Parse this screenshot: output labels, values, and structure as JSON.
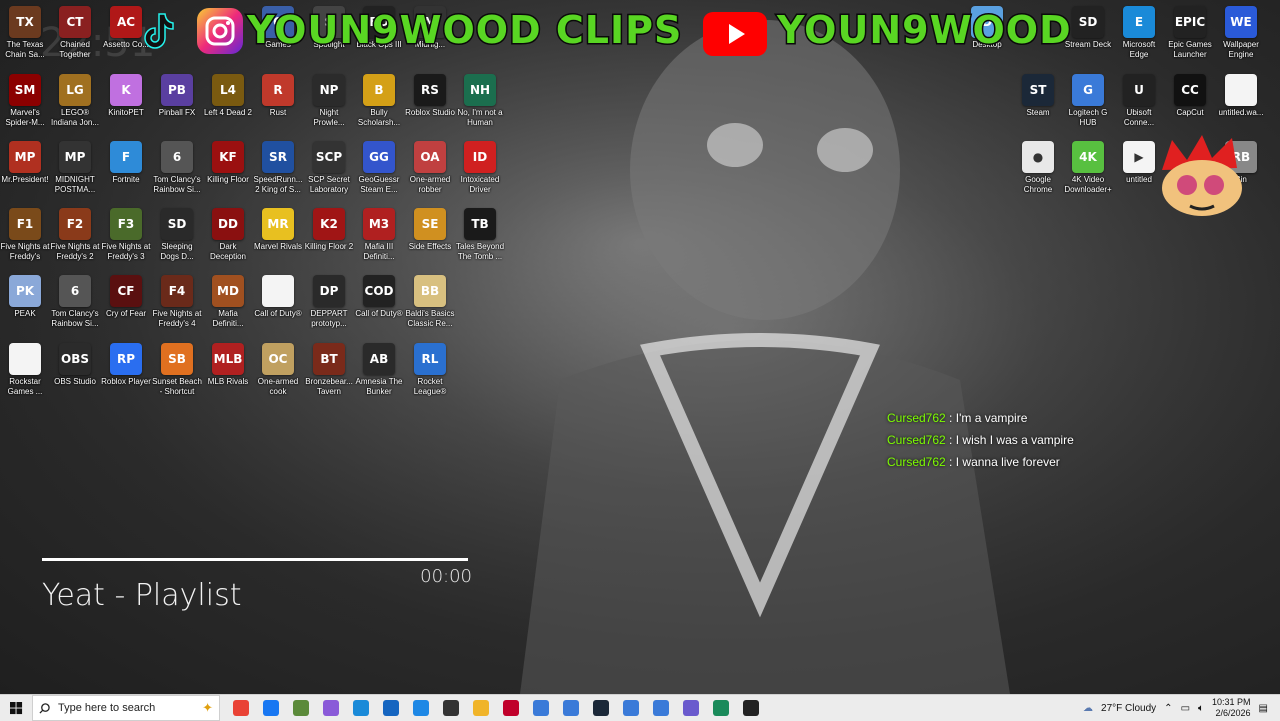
{
  "desktop": {
    "icons": [
      {
        "label": "The Texas Chain Sa...",
        "color": "#6b3a1f",
        "glyph": "TX"
      },
      {
        "label": "Chained Together",
        "color": "#8a2020",
        "glyph": "CT"
      },
      {
        "label": "Assetto Co...",
        "color": "#b01818",
        "glyph": "AC"
      },
      {
        "label": "Games",
        "color": "#3a5fa8",
        "glyph": "G"
      },
      {
        "label": "Spotlight",
        "color": "#444",
        "glyph": "S"
      },
      {
        "label": "Black Ops III",
        "color": "#222",
        "glyph": "BO"
      },
      {
        "label": "Midnig...",
        "color": "#333",
        "glyph": "M"
      },
      {
        "label": "Marvel's Spider-M...",
        "color": "#8b0000",
        "glyph": "SM"
      },
      {
        "label": "LEGO® Indiana Jon...",
        "color": "#a07020",
        "glyph": "LG"
      },
      {
        "label": "KinitoPET",
        "color": "#c070e0",
        "glyph": "K"
      },
      {
        "label": "Pinball FX",
        "color": "#5a3fa0",
        "glyph": "PB"
      },
      {
        "label": "Left 4 Dead 2",
        "color": "#7a5a10",
        "glyph": "L4"
      },
      {
        "label": "Rust",
        "color": "#c0392b",
        "glyph": "R"
      },
      {
        "label": "Night Prowle...",
        "color": "#2b2b2b",
        "glyph": "NP"
      },
      {
        "label": "Bully Scholarsh...",
        "color": "#d4a017",
        "glyph": "B"
      },
      {
        "label": "Roblox Studio",
        "color": "#1a1a1a",
        "glyph": "RS"
      },
      {
        "label": "No, I'm not a Human",
        "color": "#1b6e4e",
        "glyph": "NH"
      },
      {
        "label": "Mr.President!",
        "color": "#b03020",
        "glyph": "MP"
      },
      {
        "label": "MIDNIGHT POSTMA...",
        "color": "#333",
        "glyph": "MP"
      },
      {
        "label": "Fortnite",
        "color": "#2e8bd8",
        "glyph": "F"
      },
      {
        "label": "Tom Clancy's Rainbow Si...",
        "color": "#555",
        "glyph": "6"
      },
      {
        "label": "Killing Floor",
        "color": "#9b1010",
        "glyph": "KF"
      },
      {
        "label": "SpeedRunn... 2 King of S...",
        "color": "#2050a0",
        "glyph": "SR"
      },
      {
        "label": "SCP Secret Laboratory",
        "color": "#333",
        "glyph": "SCP"
      },
      {
        "label": "GeoGuessr Steam E...",
        "color": "#3355cc",
        "glyph": "GG"
      },
      {
        "label": "One-armed robber",
        "color": "#c04040",
        "glyph": "OA"
      },
      {
        "label": "Intoxicated Driver",
        "color": "#d02020",
        "glyph": "ID"
      },
      {
        "label": "Five Nights at Freddy's",
        "color": "#7a4a1a",
        "glyph": "F1"
      },
      {
        "label": "Five Nights at Freddy's 2",
        "color": "#8a3a1a",
        "glyph": "F2"
      },
      {
        "label": "Five Nights at Freddy's 3",
        "color": "#4a6a2a",
        "glyph": "F3"
      },
      {
        "label": "Sleeping Dogs D...",
        "color": "#2a2a2a",
        "glyph": "SD"
      },
      {
        "label": "Dark Deception",
        "color": "#8a1010",
        "glyph": "DD"
      },
      {
        "label": "Marvel Rivals",
        "color": "#e8c020",
        "glyph": "MR"
      },
      {
        "label": "Killing Floor 2",
        "color": "#a01515",
        "glyph": "K2"
      },
      {
        "label": "Mafia III Definiti...",
        "color": "#b02020",
        "glyph": "M3"
      },
      {
        "label": "Side Effects",
        "color": "#d09020",
        "glyph": "SE"
      },
      {
        "label": "Tales Beyond The Tomb ...",
        "color": "#1a1a1a",
        "glyph": "TB"
      },
      {
        "label": "PEAK",
        "color": "#8aa8d8",
        "glyph": "PK"
      },
      {
        "label": "Tom Clancy's Rainbow Si...",
        "color": "#555",
        "glyph": "6"
      },
      {
        "label": "Cry of Fear",
        "color": "#5a1010",
        "glyph": "CF"
      },
      {
        "label": "Five Nights at Freddy's 4",
        "color": "#6a2a1a",
        "glyph": "F4"
      },
      {
        "label": "Mafia Definiti...",
        "color": "#a05020",
        "glyph": "MD"
      },
      {
        "label": "Call of Duty®",
        "color": "#f4f4f4",
        "glyph": ""
      },
      {
        "label": "DEPPART prototyp...",
        "color": "#2a2a2a",
        "glyph": "DP"
      },
      {
        "label": "Call of Duty®",
        "color": "#222",
        "glyph": "COD"
      },
      {
        "label": "Baldi's Basics Classic Re...",
        "color": "#d8c080",
        "glyph": "BB"
      },
      {
        "label": "Rockstar Games ...",
        "color": "#f4f4f4",
        "glyph": ""
      },
      {
        "label": "OBS Studio",
        "color": "#2b2b2b",
        "glyph": "OBS"
      },
      {
        "label": "Roblox Player",
        "color": "#2a6ef0",
        "glyph": "RP"
      },
      {
        "label": "Sunset Beach - Shortcut",
        "color": "#e07020",
        "glyph": "SB"
      },
      {
        "label": "MLB Rivals",
        "color": "#b02020",
        "glyph": "MLB"
      },
      {
        "label": "One-armed cook",
        "color": "#c0a060",
        "glyph": "OC"
      },
      {
        "label": "Bronzebear... Tavern",
        "color": "#7a2a1a",
        "glyph": "BT"
      },
      {
        "label": "Amnesia The Bunker",
        "color": "#2a2a2a",
        "glyph": "AB"
      },
      {
        "label": "Rocket League®",
        "color": "#2a70d0",
        "glyph": "RL"
      },
      {
        "label": "Stream Deck",
        "color": "#222",
        "glyph": "SD"
      },
      {
        "label": "Microsoft Edge",
        "color": "#1a8ad8",
        "glyph": "E"
      },
      {
        "label": "Epic Games Launcher",
        "color": "#222",
        "glyph": "EPIC"
      },
      {
        "label": "Wallpaper Engine",
        "color": "#2a5ad8",
        "glyph": "WE"
      },
      {
        "label": "Steam",
        "color": "#1b2838",
        "glyph": "ST"
      },
      {
        "label": "Logitech G HUB",
        "color": "#3a7ad8",
        "glyph": "G"
      },
      {
        "label": "Ubisoft Conne...",
        "color": "#222",
        "glyph": "U"
      },
      {
        "label": "CapCut",
        "color": "#111",
        "glyph": "CC"
      },
      {
        "label": "untitled.wa...",
        "color": "#f4f4f4",
        "glyph": ""
      },
      {
        "label": "Google Chrome",
        "color": "#e8e8e8",
        "glyph": "●"
      },
      {
        "label": "4K Video Downloader+",
        "color": "#58c040",
        "glyph": "4K"
      },
      {
        "label": "untitled",
        "color": "#f4f4f4",
        "glyph": "▶"
      },
      {
        "label": "Desktop",
        "color": "#5aa0e0",
        "glyph": "D"
      },
      {
        "label": "Bin",
        "color": "#888",
        "glyph": "RB"
      }
    ]
  },
  "overlay": {
    "banner_left": "YOUN9WOOD CLIPS",
    "banner_right": "YOUN9WOOD",
    "clock_ghost": "22:51"
  },
  "chat": [
    {
      "user": "Cursed762",
      "sep": " : ",
      "text": "I'm a vampire"
    },
    {
      "user": "Cursed762",
      "sep": " : ",
      "text": "I wish I was a vampire"
    },
    {
      "user": "Cursed762",
      "sep": " : ",
      "text": "I wanna live forever"
    }
  ],
  "player": {
    "title": "Yeat - Playlist",
    "time": "00:00",
    "progress": 0
  },
  "taskbar": {
    "search_placeholder": "Type here to search",
    "apps": [
      {
        "name": "chrome",
        "color": "#e94235"
      },
      {
        "name": "facebook",
        "color": "#1877f2"
      },
      {
        "name": "minecraft",
        "color": "#5b8a3a"
      },
      {
        "name": "copilot",
        "color": "#8a5ad8"
      },
      {
        "name": "edge",
        "color": "#1a8ad8"
      },
      {
        "name": "store",
        "color": "#1565c0"
      },
      {
        "name": "mail",
        "color": "#1e88e5"
      },
      {
        "name": "roblox-studio",
        "color": "#333"
      },
      {
        "name": "file-explorer",
        "color": "#f0b429"
      },
      {
        "name": "media-app",
        "color": "#c0002a"
      },
      {
        "name": "window-a",
        "color": "#3a7ad8"
      },
      {
        "name": "window-b",
        "color": "#3a7ad8"
      },
      {
        "name": "steam",
        "color": "#1b2838"
      },
      {
        "name": "window-c",
        "color": "#3a7ad8"
      },
      {
        "name": "window-d",
        "color": "#3a7ad8"
      },
      {
        "name": "discord-like",
        "color": "#6a5acd"
      },
      {
        "name": "capture-app",
        "color": "#1a8a5a"
      },
      {
        "name": "obs",
        "color": "#222"
      }
    ],
    "weather": "27°F  Cloudy",
    "time": "10:31 PM",
    "date": "2/6/2026"
  },
  "colors": {
    "banner_green": "#59d623",
    "chat_user": "#7CFC00"
  }
}
